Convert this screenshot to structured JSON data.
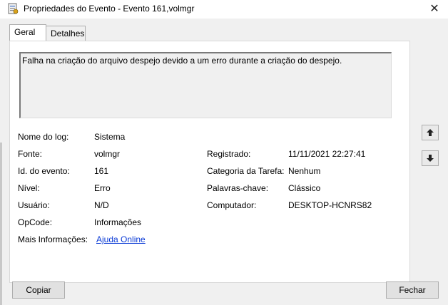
{
  "window": {
    "title": "Propriedades do Evento - Evento 161,volmgr",
    "close_symbol": "✕"
  },
  "tabs": [
    {
      "label": "Geral",
      "active": true
    },
    {
      "label": "Detalhes",
      "active": false
    }
  ],
  "message": "Falha na criação do arquivo despejo devido a um erro durante a criação do despejo.",
  "fields": {
    "log_name": {
      "label": "Nome do log:",
      "value": "Sistema"
    },
    "source": {
      "label": "Fonte:",
      "value": "volmgr"
    },
    "registered": {
      "label": "Registrado:",
      "value": "11/11/2021 22:27:41"
    },
    "event_id": {
      "label": "Id. do evento:",
      "value": "161"
    },
    "task_category": {
      "label": "Categoria da Tarefa:",
      "value": "Nenhum"
    },
    "level": {
      "label": "Nível:",
      "value": "Erro"
    },
    "keywords": {
      "label": "Palavras-chave:",
      "value": "Clássico"
    },
    "user": {
      "label": "Usuário:",
      "value": "N/D"
    },
    "computer": {
      "label": "Computador:",
      "value": "DESKTOP-HCNRS82"
    },
    "opcode": {
      "label": "OpCode:",
      "value": "Informações"
    },
    "more_info": {
      "label": "Mais Informações:",
      "link": "Ajuda Online"
    }
  },
  "buttons": {
    "copy": "Copiar",
    "close": "Fechar"
  },
  "colors": {
    "link": "#0b3bd6",
    "dialog_bg": "#f0f0f0",
    "panel_bg": "#ffffff"
  }
}
